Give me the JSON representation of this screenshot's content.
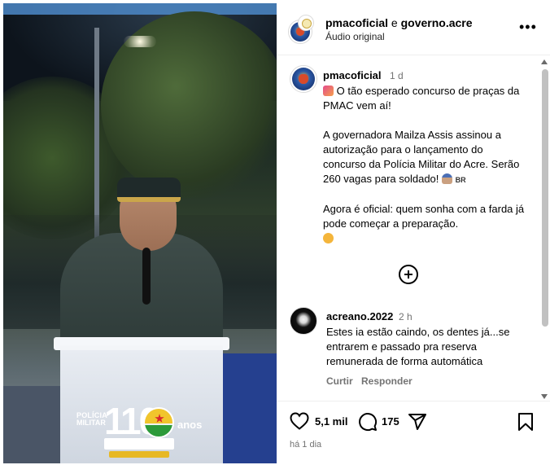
{
  "header": {
    "user1": "pmacoficial",
    "conj": "e",
    "user2": "governo.acre",
    "audio": "Áudio original"
  },
  "post": {
    "user": "pmacoficial",
    "time": "1 d",
    "caption_lines": [
      "O tão esperado concurso de praças da PMAC vem aí!",
      "A governadora Mailza Assis assinou a autorização para o lançamento do concurso da Polícia Militar do Acre. Serão 260 vagas para soldado!",
      "Agora é oficial: quem sonha com a farda já pode começar a preparação."
    ],
    "br_tag": "BR"
  },
  "comment": {
    "user": "acreano.2022",
    "time": "2 h",
    "text": "Estes ia estão caindo, os dentes já...se entrarem e passado pra reserva remunerada de forma automática",
    "reply_like": "Curtir",
    "reply": "Responder"
  },
  "actions": {
    "likes": "5,1 mil",
    "comments": "175",
    "date": "há 1 dia"
  },
  "media_logo": {
    "line1": "POLÍCIA",
    "line2": "MILITAR",
    "number": "110",
    "anos": "anos"
  },
  "icons": {
    "more": "more-horizontal-icon",
    "add": "add-comment-icon",
    "like": "heart-icon",
    "comment": "comment-bubble-icon",
    "share": "paper-plane-icon",
    "save": "bookmark-icon"
  }
}
